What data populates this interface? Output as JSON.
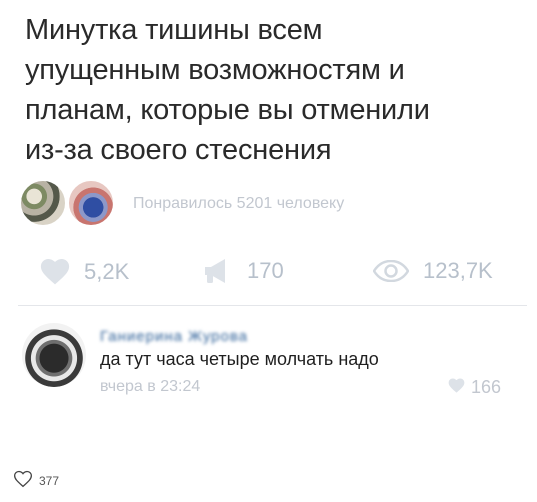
{
  "post": {
    "text": "Минутка тишины всем\nупущенным возможностям и\nпланам, которые вы отменили\nиз-за своего стеснения",
    "likes_summary": "Понравилось 5201 человеку"
  },
  "stats": {
    "likes": "5,2K",
    "reposts": "170",
    "views": "123,7K"
  },
  "comment": {
    "author": "Ганиерина Журова",
    "text": "да тут часа четыре молчать надо",
    "time": "вчера в 23:24",
    "likes": "166"
  },
  "footer": {
    "likes": "377"
  },
  "icons": {
    "like": "heart-icon",
    "repost": "megaphone-icon",
    "views": "eye-icon"
  },
  "colors": {
    "muted": "#b7c0cb",
    "author_link": "#2c5f97"
  }
}
